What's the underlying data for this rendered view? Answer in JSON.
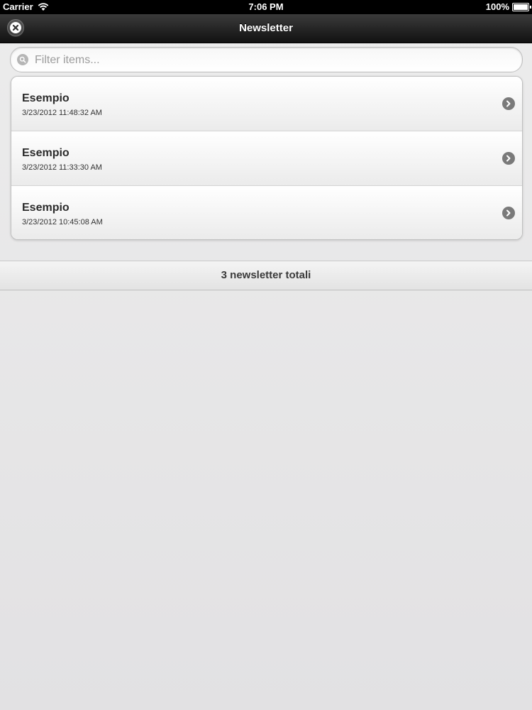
{
  "status_bar": {
    "carrier": "Carrier",
    "time": "7:06 PM",
    "battery": "100%"
  },
  "nav": {
    "title": "Newsletter"
  },
  "search": {
    "placeholder": "Filter items..."
  },
  "list": {
    "items": [
      {
        "title": "Esempio",
        "date": "3/23/2012 11:48:32 AM"
      },
      {
        "title": "Esempio",
        "date": "3/23/2012 11:33:30 AM"
      },
      {
        "title": "Esempio",
        "date": "3/23/2012 10:45:08 AM"
      }
    ]
  },
  "footer": {
    "total": "3 newsletter totali"
  },
  "icons": {
    "close": "close-icon",
    "search": "search-icon",
    "disclosure": "chevron-right-icon",
    "wifi": "wifi-icon",
    "battery": "battery-icon"
  },
  "colors": {
    "navbar": "#1e1e1e",
    "background": "#e6e6e6",
    "text": "#2b2b2b"
  }
}
